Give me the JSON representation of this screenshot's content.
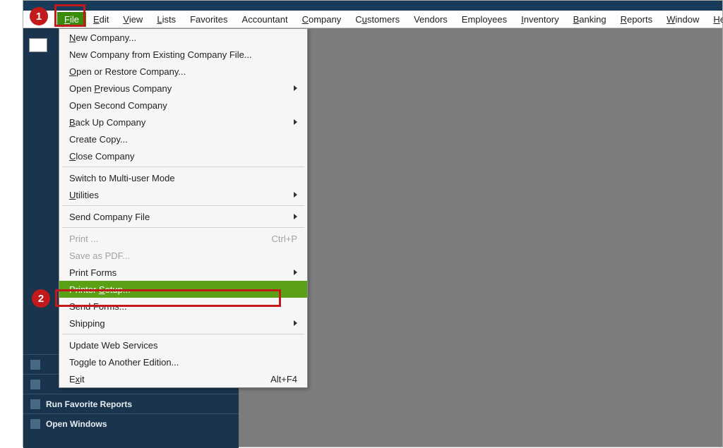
{
  "menubar": {
    "items": [
      {
        "label": "File",
        "underline": "F",
        "rest": "ile",
        "active": true
      },
      {
        "label": "Edit",
        "underline": "E",
        "rest": "dit"
      },
      {
        "label": "View",
        "underline": "V",
        "rest": "iew"
      },
      {
        "label": "Lists",
        "underline": "L",
        "rest": "ists"
      },
      {
        "label": "Favorites",
        "underline": "F",
        "rest": "avorites",
        "noUnderline": true
      },
      {
        "label": "Accountant",
        "underline": "A",
        "rest": "ccountant",
        "noUnderline": true
      },
      {
        "label": "Company",
        "underline": "C",
        "rest": "ompany"
      },
      {
        "label": "Customers",
        "underline": "C",
        "rest": "ustomers",
        "uIndex": 1
      },
      {
        "label": "Vendors",
        "underline": "V",
        "rest": "endors",
        "noUnderline": true
      },
      {
        "label": "Employees",
        "underline": "E",
        "rest": "mployees",
        "noUnderline": true
      },
      {
        "label": "Inventory",
        "underline": "I",
        "rest": "nventory"
      },
      {
        "label": "Banking",
        "underline": "B",
        "rest": "anking"
      },
      {
        "label": "Reports",
        "underline": "R",
        "rest": "eports"
      },
      {
        "label": "Window",
        "underline": "W",
        "rest": "indow"
      },
      {
        "label": "Help",
        "underline": "H",
        "rest": "elp"
      }
    ]
  },
  "dropdown": {
    "groups": [
      [
        {
          "text": "New Company...",
          "u": "N",
          "rest": "ew Company..."
        },
        {
          "text": "New Company from Existing Company File...",
          "u": "",
          "rest": "New Company from Existing Company File..."
        },
        {
          "text": "Open or Restore Company...",
          "u": "O",
          "rest": "pen or Restore Company..."
        },
        {
          "text": "Open Previous Company",
          "pre": "Open ",
          "u": "P",
          "rest": "revious Company",
          "submenu": true
        },
        {
          "text": "Open Second Company",
          "u": "",
          "rest": "Open Second Company"
        },
        {
          "text": "Back Up Company",
          "u": "B",
          "rest": "ack Up Company",
          "submenu": true
        },
        {
          "text": "Create Copy...",
          "u": "",
          "rest": "Create Copy..."
        },
        {
          "text": "Close Company",
          "u": "C",
          "rest": "lose Company"
        }
      ],
      [
        {
          "text": "Switch to Multi-user Mode",
          "u": "",
          "rest": "Switch to Multi-user Mode"
        },
        {
          "text": "Utilities",
          "u": "U",
          "rest": "tilities",
          "submenu": true
        }
      ],
      [
        {
          "text": "Send Company File",
          "u": "",
          "rest": "Send Company File",
          "submenu": true
        }
      ],
      [
        {
          "text": "Print ...",
          "u": "",
          "rest": "Print ...",
          "shortcut": "Ctrl+P",
          "disabled": true
        },
        {
          "text": "Save as PDF...",
          "u": "",
          "rest": "Save as PDF...",
          "disabled": true
        },
        {
          "text": "Print Forms",
          "u": "",
          "rest": "Print Forms",
          "submenu": true
        },
        {
          "text": "Printer Setup...",
          "pre": "Printer ",
          "u": "S",
          "rest": "etup...",
          "highlight": true
        },
        {
          "text": "Send Forms...",
          "u": "",
          "rest": "Send Forms..."
        },
        {
          "text": "Shipping",
          "u": "",
          "rest": "Shipping",
          "submenu": true
        }
      ],
      [
        {
          "text": "Update Web Services",
          "u": "",
          "rest": "Update Web Services"
        },
        {
          "text": "Toggle to Another Edition...",
          "u": "",
          "rest": "Toggle to Another Edition..."
        },
        {
          "text": "Exit",
          "u": "",
          "pre": "E",
          "uMid": "x",
          "rest": "it",
          "shortcut": "Alt+F4"
        }
      ]
    ]
  },
  "sidebar": {
    "items": [
      {
        "label": ""
      },
      {
        "label": ""
      },
      {
        "label": "Run Favorite Reports"
      },
      {
        "label": "Open Windows"
      }
    ]
  },
  "annotations": {
    "callout1": "1",
    "callout2": "2"
  }
}
